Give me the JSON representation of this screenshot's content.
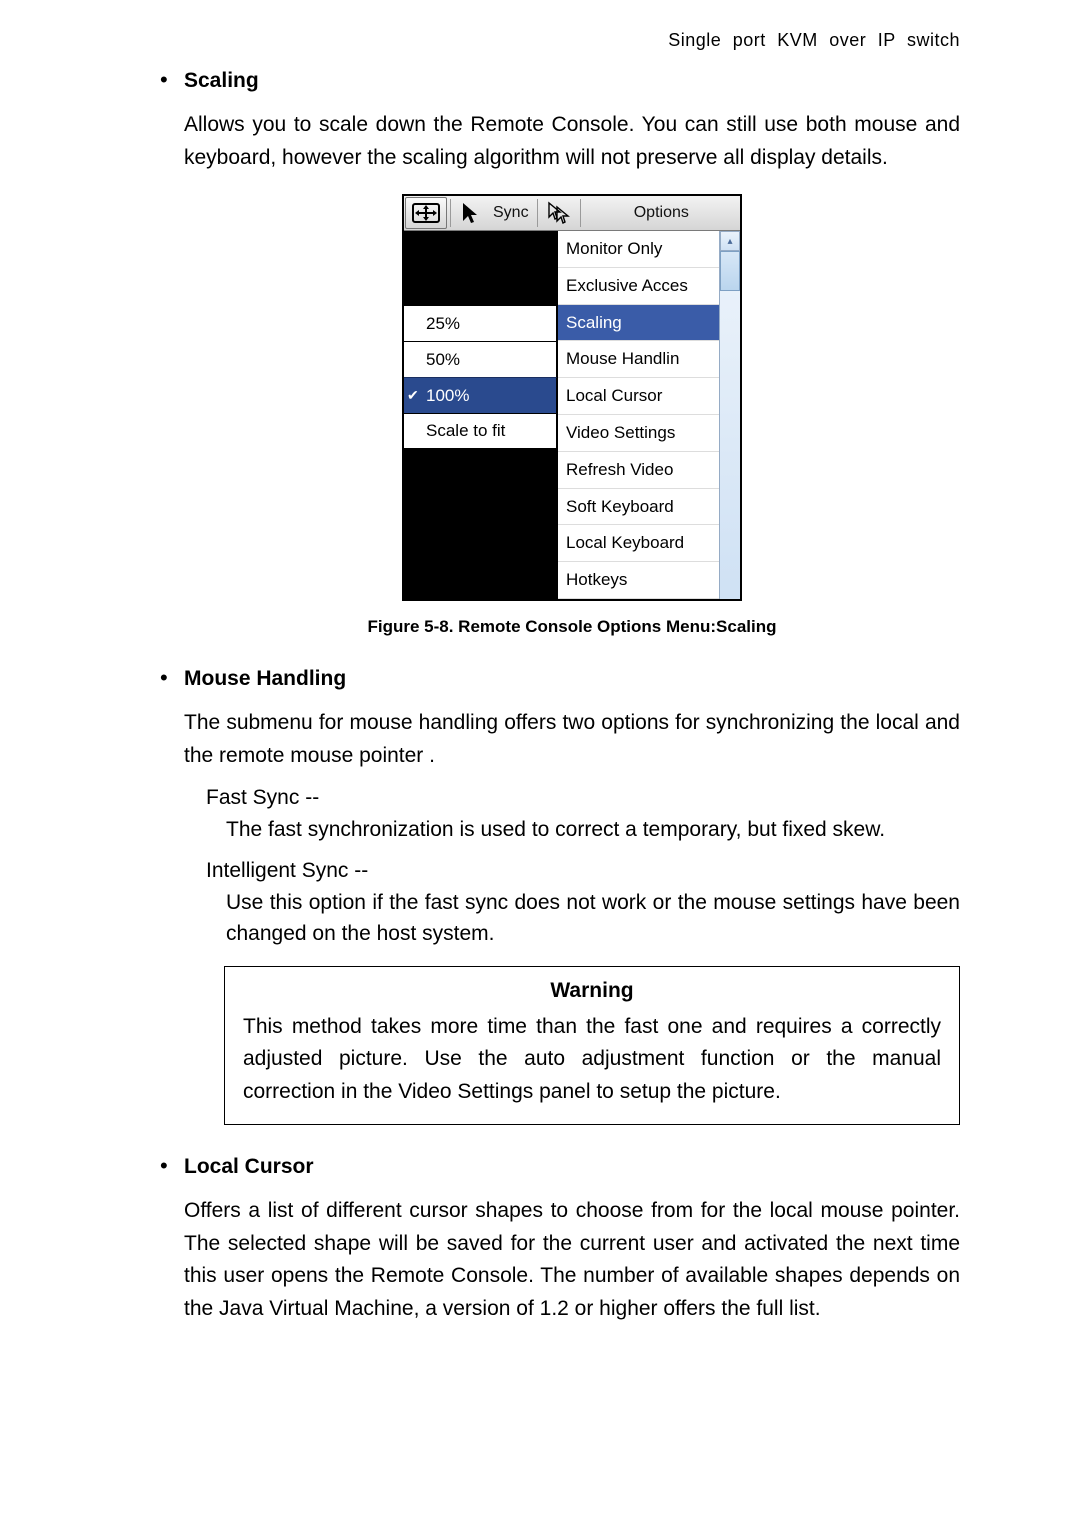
{
  "header": {
    "title": "Single port KVM over IP switch"
  },
  "sections": {
    "scaling": {
      "title": "Scaling",
      "body": "Allows you to scale down the Remote Console. You can still use both mouse and keyboard, however the scaling algorithm will not preserve all display details."
    },
    "mouse": {
      "title": "Mouse Handling",
      "body": "The submenu for mouse handling offers two options for synchronizing the local and the remote mouse pointer .",
      "fast": {
        "title": "Fast Sync --",
        "body": "The fast synchronization is used to correct a temporary, but fixed skew."
      },
      "intel": {
        "title": "Intelligent Sync --",
        "body": "Use this option if the fast sync does not work or the mouse settings have been changed on the host system."
      },
      "warning": {
        "title": "Warning",
        "body": "This method takes more time than the fast one and requires a correctly adjusted picture. Use the auto adjustment function or the manual correction in the Video Settings panel to setup the picture."
      }
    },
    "cursor": {
      "title": "Local Cursor",
      "body": "Offers a list of different cursor shapes to choose from for the local mouse pointer. The selected shape will be saved for the current user and activated the next time this user opens the Remote Console. The number of available shapes depends on the Java Virtual Machine, a version of 1.2 or higher offers the full list."
    }
  },
  "figure": {
    "caption": "Figure 5-8. Remote Console Options Menu:Scaling"
  },
  "rc": {
    "toolbar": {
      "sync": "Sync",
      "options": "Options"
    },
    "submenu": {
      "i0": "25%",
      "i1": "50%",
      "i2": "100%",
      "i3": "Scale to fit"
    },
    "menu": {
      "m0": "Monitor Only",
      "m1": "Exclusive Acces",
      "m2": "Scaling",
      "m3": "Mouse Handlin",
      "m4": "Local Cursor",
      "m5": "Video Settings",
      "m6": "Refresh Video",
      "m7": "Soft Keyboard",
      "m8": "Local Keyboard",
      "m9": "Hotkeys"
    },
    "scroll": {
      "up": "▴"
    }
  }
}
